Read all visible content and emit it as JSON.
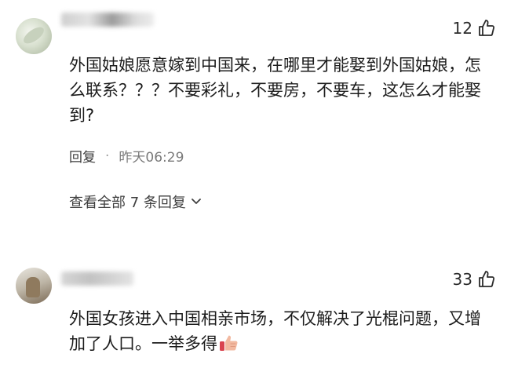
{
  "comments": [
    {
      "likes": "12",
      "text": "外国姑娘愿意嫁到中国来，在哪里才能娶到外国姑娘，怎么联系？？？不要彩礼，不要房，不要车，这怎么才能娶到?",
      "reply_label": "回复",
      "separator": "·",
      "time": "昨天06:29",
      "view_replies": "查看全部 7 条回复"
    },
    {
      "likes": "33",
      "text": "外国女孩进入中国相亲市场，不仅解决了光棍问题，又增加了人口。一举多得"
    }
  ],
  "colors": {
    "text": "#1c1c1c",
    "meta": "#7a7a7a",
    "emoji_skin": "#f2b9a0",
    "emoji_cuff": "#d9434f"
  },
  "icons": {
    "like": "thumbs-up-outline-icon",
    "more": "chevron-down-icon",
    "emoji": "thumbs-up-emoji"
  }
}
